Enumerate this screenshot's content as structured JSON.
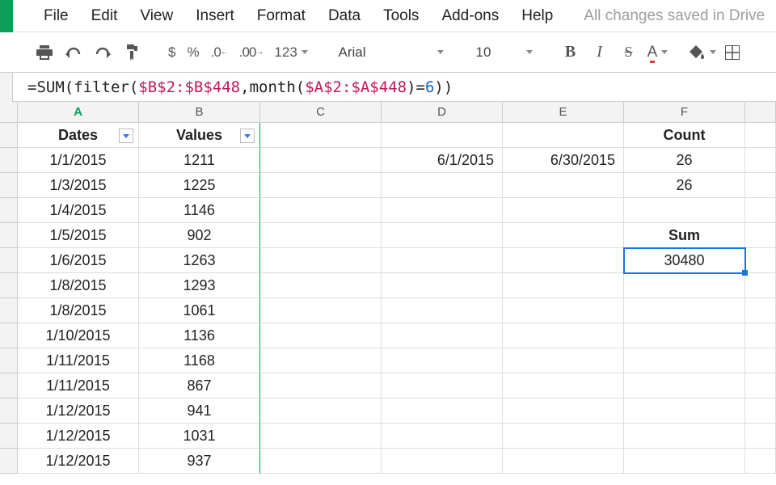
{
  "menu": {
    "items": [
      "File",
      "Edit",
      "View",
      "Insert",
      "Format",
      "Data",
      "Tools",
      "Add-ons",
      "Help"
    ],
    "save_status": "All changes saved in Drive"
  },
  "toolbar": {
    "currency": "$",
    "percent": "%",
    "dec_dec": ".0",
    "inc_dec": ".00",
    "num_123": "123",
    "font_name": "Arial",
    "font_size": "10",
    "bold": "B",
    "italic": "I",
    "strike": "S",
    "textcolor": "A"
  },
  "formula": {
    "pre": "=SUM(",
    "fn1": "filter(",
    "ref1": "$B$2:$B$448",
    "sep1": ",",
    "fn2": "month(",
    "ref2": "$A$2:$A$448",
    "sep2": ")=",
    "num": "6",
    "post": "))"
  },
  "columns": [
    "A",
    "B",
    "C",
    "D",
    "E",
    "F"
  ],
  "headers": {
    "A": "Dates",
    "B": "Values",
    "F": "Count"
  },
  "rows": [
    {
      "A": "1/1/2015",
      "B": "1211",
      "D": "6/1/2015",
      "E": "6/30/2015",
      "F": "26"
    },
    {
      "A": "1/3/2015",
      "B": "1225",
      "F": "26"
    },
    {
      "A": "1/4/2015",
      "B": "1146"
    },
    {
      "A": "1/5/2015",
      "B": "902",
      "F": "Sum",
      "Fbold": true
    },
    {
      "A": "1/6/2015",
      "B": "1263",
      "F": "30480",
      "Factive": true
    },
    {
      "A": "1/8/2015",
      "B": "1293"
    },
    {
      "A": "1/8/2015",
      "B": "1061"
    },
    {
      "A": "1/10/2015",
      "B": "1136"
    },
    {
      "A": "1/11/2015",
      "B": "1168"
    },
    {
      "A": "1/11/2015",
      "B": "867"
    },
    {
      "A": "1/12/2015",
      "B": "941"
    },
    {
      "A": "1/12/2015",
      "B": "1031"
    },
    {
      "A": "1/12/2015",
      "B": "937"
    }
  ]
}
